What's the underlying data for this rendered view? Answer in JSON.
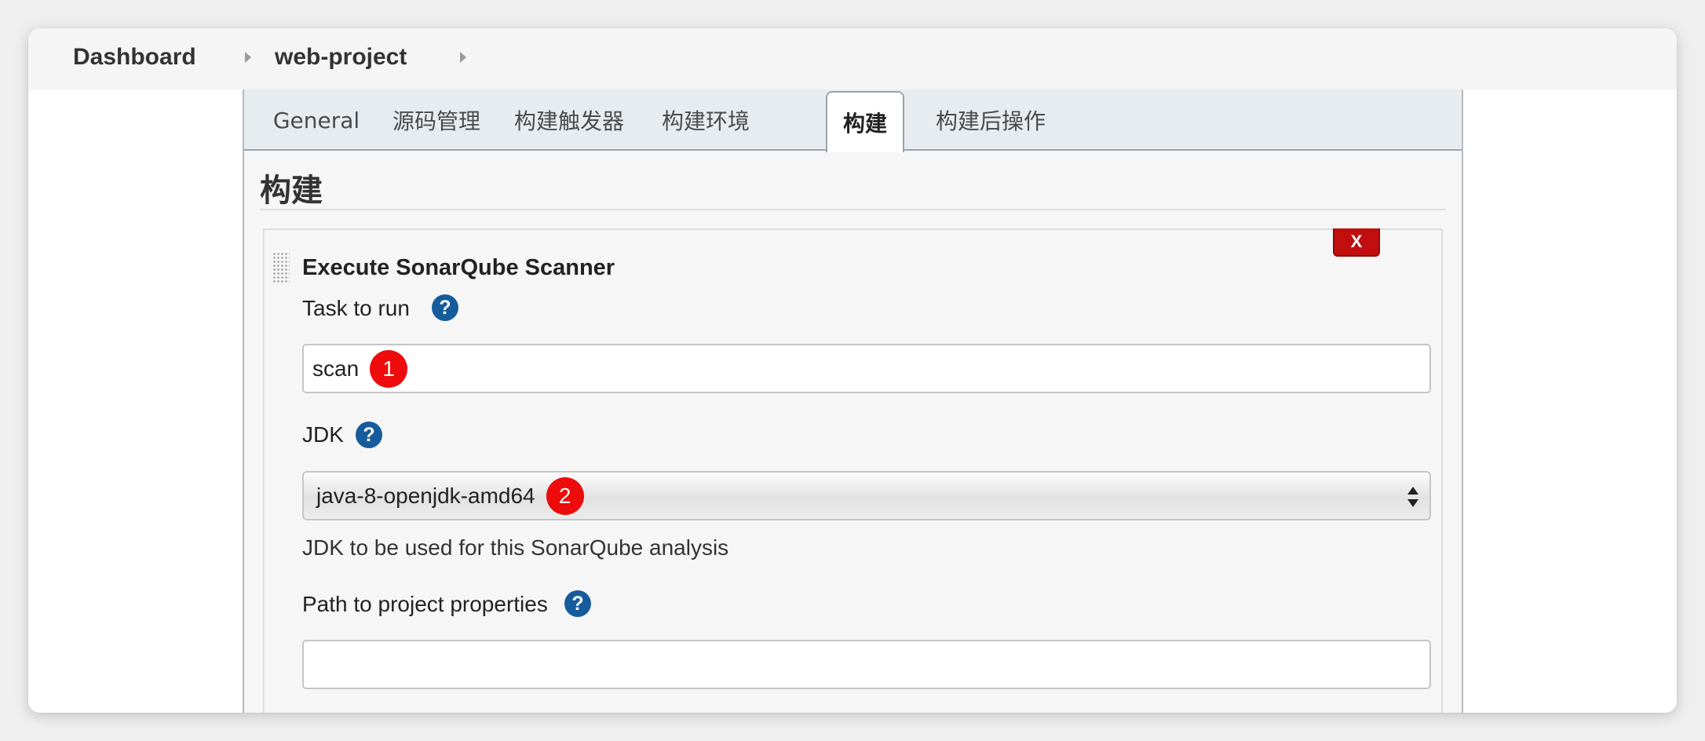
{
  "breadcrumb": {
    "items": [
      "Dashboard",
      "web-project"
    ]
  },
  "tabs": [
    {
      "label": "General",
      "active": false
    },
    {
      "label": "源码管理",
      "active": false
    },
    {
      "label": "构建触发器",
      "active": false
    },
    {
      "label": "构建环境",
      "active": false
    },
    {
      "label": "构建",
      "active": true
    },
    {
      "label": "构建后操作",
      "active": false
    }
  ],
  "section": {
    "title": "构建"
  },
  "builder": {
    "title": "Execute SonarQube Scanner",
    "delete_label": "X",
    "task": {
      "label": "Task to run",
      "value": "scan",
      "marker": "1"
    },
    "jdk": {
      "label": "JDK",
      "selected": "java-8-openjdk-amd64",
      "marker": "2",
      "help_text": "JDK to be used for this SonarQube analysis"
    },
    "path": {
      "label": "Path to project properties",
      "value": ""
    },
    "help_glyph": "?"
  },
  "colors": {
    "delete_red": "#c10f10",
    "help_blue": "#165c9c",
    "marker_red": "#ee0b0b"
  }
}
